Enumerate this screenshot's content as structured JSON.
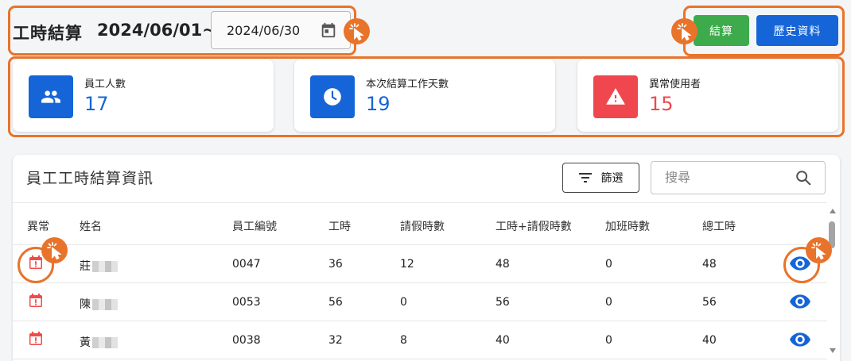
{
  "header": {
    "title": "工時結算",
    "date_start": "2024/06/01~",
    "date_end": "2024/06/30",
    "settle_label": "結算",
    "history_label": "歷史資料"
  },
  "colors": {
    "primary": "#1565d8",
    "success": "#3daa4b",
    "danger": "#f0474f",
    "highlight": "#e8732b"
  },
  "stats": [
    {
      "label": "員工人數",
      "value": "17",
      "icon": "people-icon",
      "color": "#1565d8"
    },
    {
      "label": "本次結算工作天數",
      "value": "19",
      "icon": "clock-icon",
      "color": "#1565d8"
    },
    {
      "label": "異常使用者",
      "value": "15",
      "icon": "warning-icon",
      "color": "#f0474f"
    }
  ],
  "table": {
    "title": "員工工時結算資訊",
    "filter_label": "篩選",
    "search_placeholder": "搜尋",
    "columns": [
      "異常",
      "姓名",
      "員工編號",
      "工時",
      "請假時數",
      "工時+請假時數",
      "加班時數",
      "總工時"
    ],
    "rows": [
      {
        "name": "莊",
        "id": "0047",
        "hours": "36",
        "leave": "12",
        "hours_leave": "48",
        "overtime": "0",
        "total": "48"
      },
      {
        "name": "陳",
        "id": "0053",
        "hours": "56",
        "leave": "0",
        "hours_leave": "56",
        "overtime": "0",
        "total": "56"
      },
      {
        "name": "黃",
        "id": "0038",
        "hours": "32",
        "leave": "8",
        "hours_leave": "40",
        "overtime": "0",
        "total": "40"
      }
    ]
  }
}
